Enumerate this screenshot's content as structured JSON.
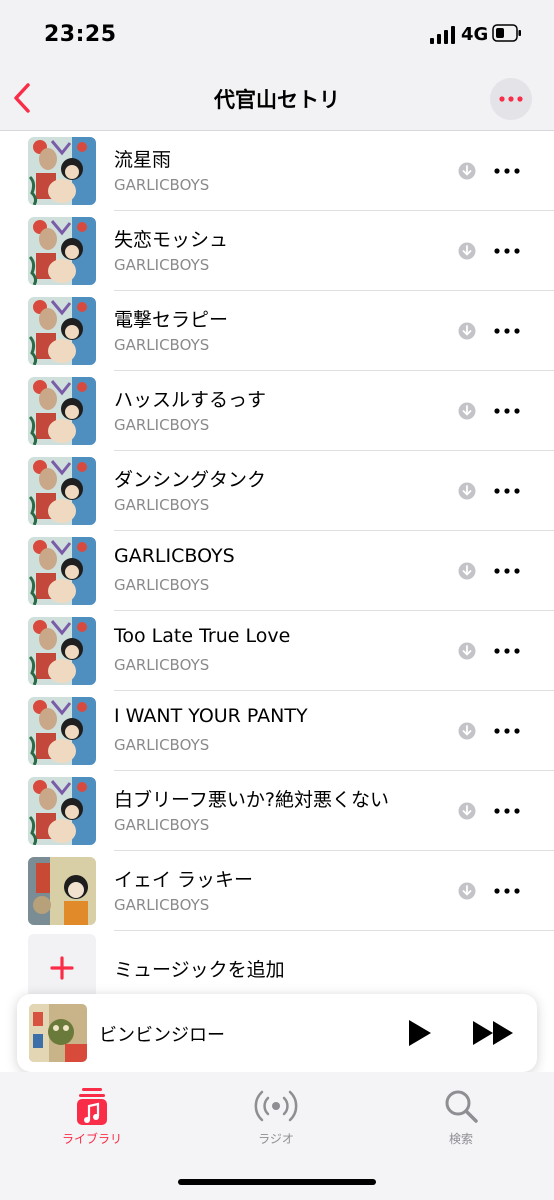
{
  "status_bar": {
    "time": "23:25",
    "network": "4G"
  },
  "nav": {
    "title": "代官山セトリ"
  },
  "songs": [
    {
      "title": "流星雨",
      "artist": "GARLICBOYS",
      "art": "album-a"
    },
    {
      "title": "失恋モッシュ",
      "artist": "GARLICBOYS",
      "art": "album-a"
    },
    {
      "title": "電撃セラピー",
      "artist": "GARLICBOYS",
      "art": "album-a"
    },
    {
      "title": "ハッスルするっす",
      "artist": "GARLICBOYS",
      "art": "album-a"
    },
    {
      "title": "ダンシングタンク",
      "artist": "GARLICBOYS",
      "art": "album-a"
    },
    {
      "title": "GARLICBOYS",
      "artist": "GARLICBOYS",
      "art": "album-a"
    },
    {
      "title": "Too Late True Love",
      "artist": "GARLICBOYS",
      "art": "album-a"
    },
    {
      "title": "I WANT YOUR PANTY",
      "artist": "GARLICBOYS",
      "art": "album-a"
    },
    {
      "title": "白ブリーフ悪いか?絶対悪くない",
      "artist": "GARLICBOYS",
      "art": "album-a"
    },
    {
      "title": "イェイ ラッキー",
      "artist": "GARLICBOYS",
      "art": "album-b"
    }
  ],
  "add_music": {
    "label": "ミュージックを追加"
  },
  "now_playing": {
    "title": "ビンビンジロー"
  },
  "tabs": [
    {
      "label": "ライブラリ",
      "icon": "music-note-icon",
      "active": true
    },
    {
      "label": "ラジオ",
      "icon": "radio-broadcast-icon",
      "active": false
    },
    {
      "label": "検索",
      "icon": "search-icon",
      "active": false
    }
  ],
  "colors": {
    "accent": "#fa2d48",
    "secondary_text": "#8a8a8e",
    "background": "#ffffff",
    "inactive_tab": "#8e8e93"
  }
}
